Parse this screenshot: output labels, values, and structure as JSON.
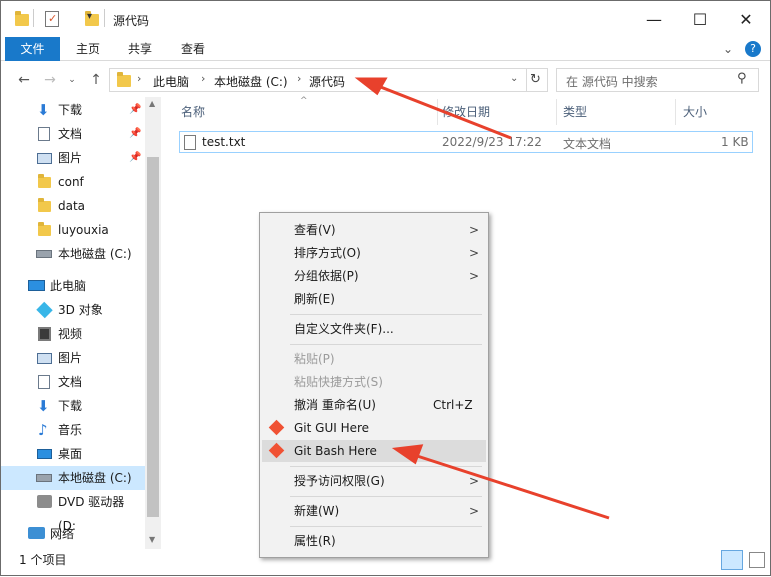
{
  "window": {
    "title": "源代码",
    "minimize": "—",
    "maximize": "☐",
    "close": "✕"
  },
  "ribbon": {
    "tabs": [
      "文件",
      "主页",
      "共享",
      "查看"
    ],
    "expand": "⌄",
    "help": "?"
  },
  "address": {
    "path": [
      "此电脑",
      "本地磁盘 (C:)",
      "源代码"
    ],
    "search_placeholder": "在 源代码 中搜索"
  },
  "nav": {
    "quick_access": [
      {
        "label": "下载",
        "icon": "download-icon",
        "pinned": true
      },
      {
        "label": "文档",
        "icon": "document-icon",
        "pinned": true
      },
      {
        "label": "图片",
        "icon": "picture-icon",
        "pinned": true
      },
      {
        "label": "conf",
        "icon": "folder-icon",
        "pinned": false
      },
      {
        "label": "data",
        "icon": "folder-icon",
        "pinned": false
      },
      {
        "label": "luyouxia",
        "icon": "folder-icon",
        "pinned": false
      },
      {
        "label": "本地磁盘 (C:)",
        "icon": "drive-icon",
        "pinned": false
      }
    ],
    "this_pc": "此电脑",
    "pc_items": [
      {
        "label": "3D 对象",
        "icon": "3d-icon"
      },
      {
        "label": "视频",
        "icon": "video-icon"
      },
      {
        "label": "图片",
        "icon": "picture-icon"
      },
      {
        "label": "文档",
        "icon": "document-icon"
      },
      {
        "label": "下载",
        "icon": "download-icon"
      },
      {
        "label": "音乐",
        "icon": "music-icon"
      },
      {
        "label": "桌面",
        "icon": "desktop-icon"
      },
      {
        "label": "本地磁盘 (C:)",
        "icon": "drive-icon"
      },
      {
        "label": "DVD 驱动器 (D:",
        "icon": "dvd-icon"
      }
    ],
    "network": "网络"
  },
  "columns": {
    "name": "名称",
    "date": "修改日期",
    "type": "类型",
    "size": "大小"
  },
  "files": [
    {
      "name": "test.txt",
      "date": "2022/9/23 17:22",
      "type": "文本文档",
      "size": "1 KB"
    }
  ],
  "status": {
    "count": "1 个项目"
  },
  "context_menu": {
    "view": "查看(V)",
    "sort": "排序方式(O)",
    "group": "分组依据(P)",
    "refresh": "刷新(E)",
    "customize": "自定义文件夹(F)...",
    "paste": "粘贴(P)",
    "paste_shortcut": "粘贴快捷方式(S)",
    "undo": "撤消 重命名(U)",
    "undo_shortcut": "Ctrl+Z",
    "git_gui": "Git GUI Here",
    "git_bash": "Git Bash Here",
    "grant_access": "授予访问权限(G)",
    "new": "新建(W)",
    "properties": "属性(R)"
  },
  "colors": {
    "accent": "#1979ca",
    "selection": "#cce8ff",
    "annotation": "#e8412c"
  }
}
